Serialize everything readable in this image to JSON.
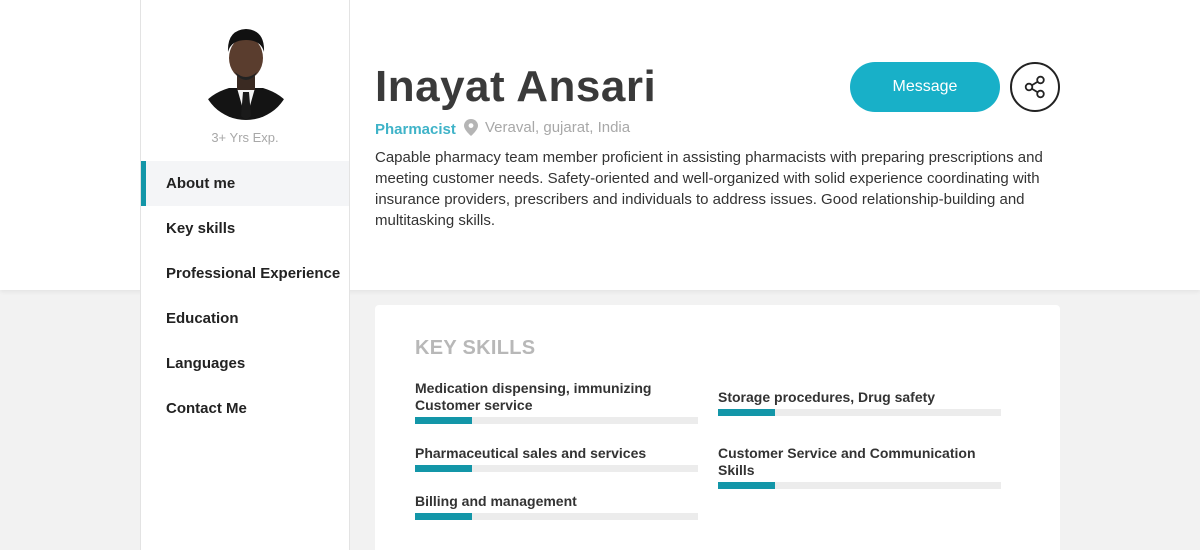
{
  "profile": {
    "experience": "3+ Yrs Exp.",
    "name": "Inayat Ansari",
    "role": "Pharmacist",
    "location": "Veraval, gujarat, India",
    "bio": "Capable pharmacy team member proficient in assisting pharmacists with preparing prescriptions and meeting customer needs. Safety-oriented and well-organized with solid experience coordinating with insurance providers, prescribers and individuals to address issues. Good relationship-building and multitasking skills."
  },
  "actions": {
    "message_label": "Message",
    "share_icon": "share-icon"
  },
  "nav": {
    "items": [
      {
        "label": "About me",
        "active": true
      },
      {
        "label": "Key skills"
      },
      {
        "label": "Professional Experience"
      },
      {
        "label": "Education"
      },
      {
        "label": "Languages"
      },
      {
        "label": "Contact Me"
      }
    ]
  },
  "key_skills": {
    "title": "KEY SKILLS",
    "items": [
      {
        "label": "Medication dispensing, immunizing Customer service",
        "level": 0.2
      },
      {
        "label": "Storage procedures, Drug safety",
        "level": 0.2
      },
      {
        "label": "Pharmaceutical sales and services",
        "level": 0.2
      },
      {
        "label": "Customer Service and Communication Skills",
        "level": 0.2
      },
      {
        "label": "Billing and management",
        "level": 0.2
      }
    ]
  },
  "colors": {
    "accent": "#18b0c8",
    "accent_dark": "#1396a8",
    "role_text": "#3fb3c8"
  }
}
